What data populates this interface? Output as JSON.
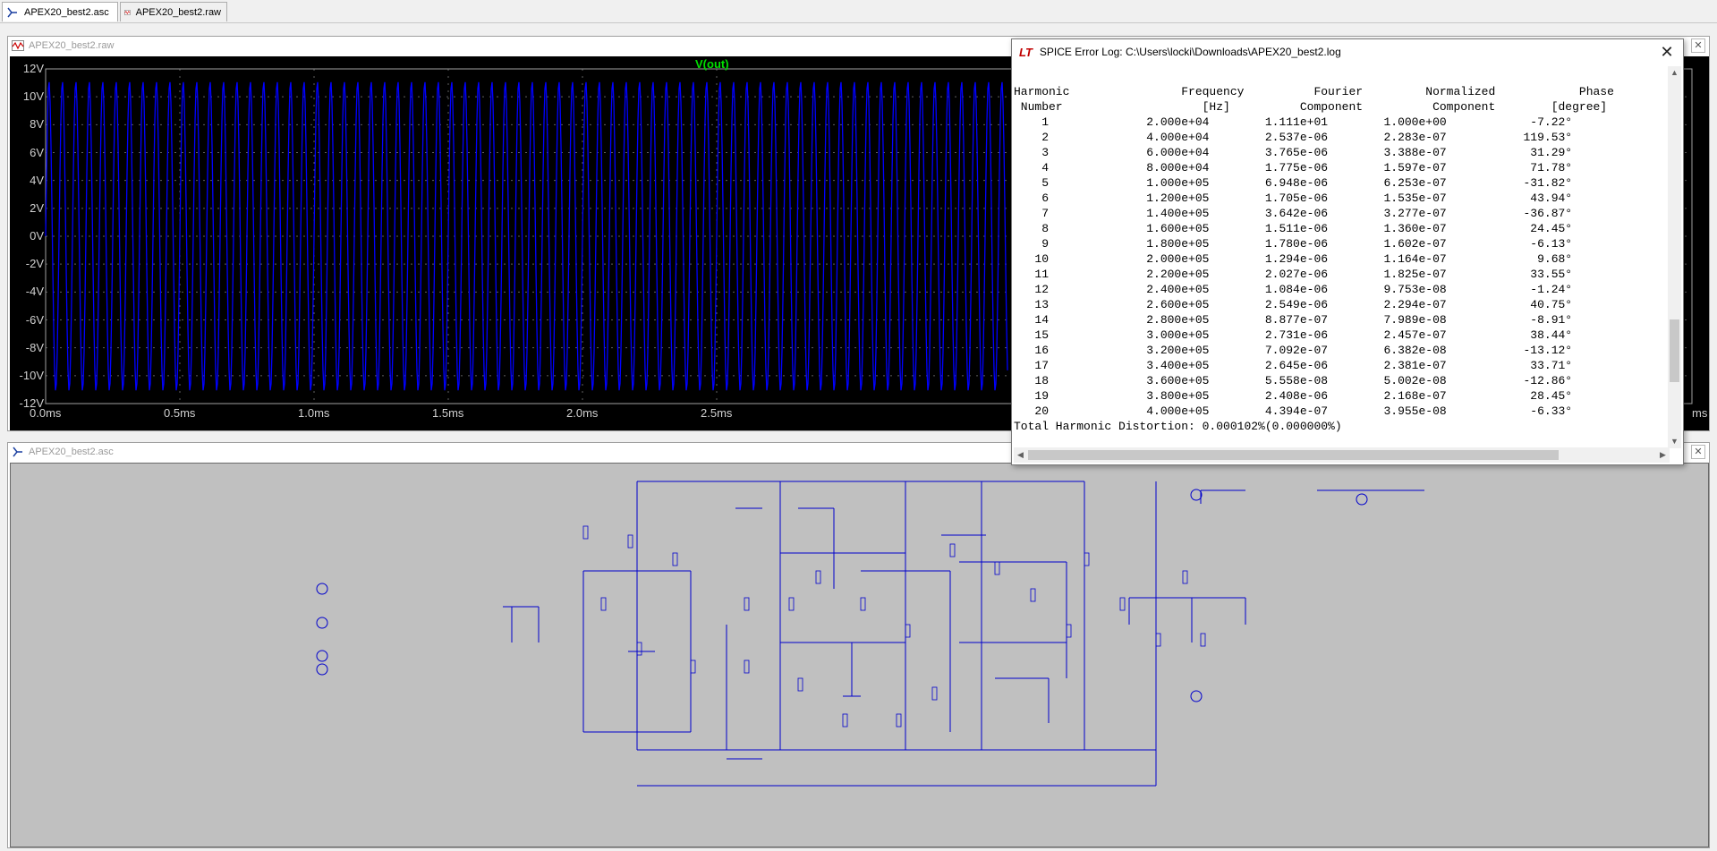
{
  "tabs": [
    {
      "label": "APEX20_best2.asc",
      "active": true
    },
    {
      "label": "APEX20_best2.raw",
      "active": false
    }
  ],
  "waveform": {
    "window_title": "APEX20_best2.raw",
    "trace_label": "V(out)",
    "trace_color": "#0000ff",
    "background": "#000000",
    "y_ticks": [
      "12V",
      "10V",
      "8V",
      "6V",
      "4V",
      "2V",
      "0V",
      "-2V",
      "-4V",
      "-6V",
      "-8V",
      "-10V",
      "-12V"
    ],
    "x_ticks": [
      "0.0ms",
      "0.5ms",
      "1.0ms",
      "1.5ms",
      "2.0ms",
      "2.5ms"
    ],
    "x_tick_last": "ms",
    "signal_frequency_hz": 20000,
    "amplitude_v": 11.11
  },
  "schematic": {
    "window_title": "APEX20_best2.asc",
    "background": "#c0c0c0",
    "wire_color": "#0000cc"
  },
  "spice_log": {
    "title": "SPICE Error Log: C:\\Users\\locki\\Downloads\\APEX20_best2.log",
    "header1": [
      "Harmonic",
      "Frequency",
      "Fourier",
      "Normalized",
      "Phase"
    ],
    "header2": [
      "Number",
      "[Hz]",
      "Component",
      "Component",
      "[degree]"
    ],
    "rows": [
      [
        "1",
        "2.000e+04",
        "1.111e+01",
        "1.000e+00",
        "-7.22°"
      ],
      [
        "2",
        "4.000e+04",
        "2.537e-06",
        "2.283e-07",
        "119.53°"
      ],
      [
        "3",
        "6.000e+04",
        "3.765e-06",
        "3.388e-07",
        "31.29°"
      ],
      [
        "4",
        "8.000e+04",
        "1.775e-06",
        "1.597e-07",
        "71.78°"
      ],
      [
        "5",
        "1.000e+05",
        "6.948e-06",
        "6.253e-07",
        "-31.82°"
      ],
      [
        "6",
        "1.200e+05",
        "1.705e-06",
        "1.535e-07",
        "43.94°"
      ],
      [
        "7",
        "1.400e+05",
        "3.642e-06",
        "3.277e-07",
        "-36.87°"
      ],
      [
        "8",
        "1.600e+05",
        "1.511e-06",
        "1.360e-07",
        "24.45°"
      ],
      [
        "9",
        "1.800e+05",
        "1.780e-06",
        "1.602e-07",
        "-6.13°"
      ],
      [
        "10",
        "2.000e+05",
        "1.294e-06",
        "1.164e-07",
        "9.68°"
      ],
      [
        "11",
        "2.200e+05",
        "2.027e-06",
        "1.825e-07",
        "33.55°"
      ],
      [
        "12",
        "2.400e+05",
        "1.084e-06",
        "9.753e-08",
        "-1.24°"
      ],
      [
        "13",
        "2.600e+05",
        "2.549e-06",
        "2.294e-07",
        "40.75°"
      ],
      [
        "14",
        "2.800e+05",
        "8.877e-07",
        "7.989e-08",
        "-8.91°"
      ],
      [
        "15",
        "3.000e+05",
        "2.731e-06",
        "2.457e-07",
        "38.44°"
      ],
      [
        "16",
        "3.200e+05",
        "7.092e-07",
        "6.382e-08",
        "-13.12°"
      ],
      [
        "17",
        "3.400e+05",
        "2.645e-06",
        "2.381e-07",
        "33.71°"
      ],
      [
        "18",
        "3.600e+05",
        "5.558e-08",
        "5.002e-08",
        "-12.86°"
      ],
      [
        "19",
        "3.800e+05",
        "2.408e-06",
        "2.168e-07",
        "28.45°"
      ],
      [
        "20",
        "4.000e+05",
        "4.394e-07",
        "3.955e-08",
        "-6.33°"
      ]
    ],
    "thd": "Total Harmonic Distortion: 0.000102%(0.000000%)"
  }
}
